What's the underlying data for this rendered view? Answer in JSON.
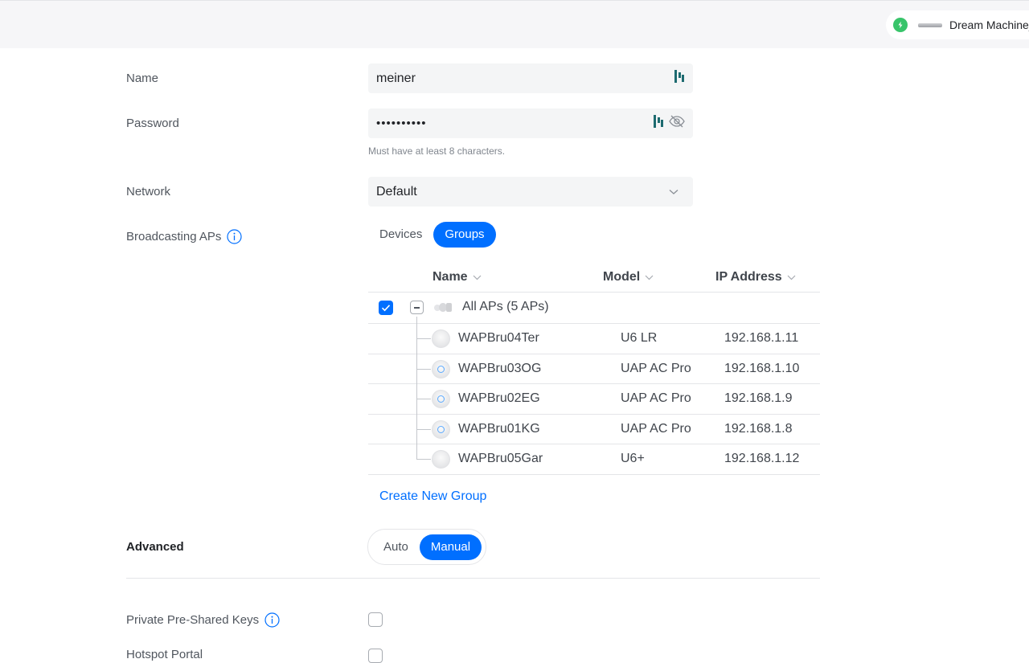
{
  "topbar": {
    "device_name": "Dream Machine_",
    "status_color": "#38c46a"
  },
  "form": {
    "name_label": "Name",
    "name_value": "meiner",
    "password_label": "Password",
    "password_value": "••••••••••",
    "password_hint": "Must have at least 8 characters.",
    "network_label": "Network",
    "network_value": "Default",
    "broadcasting_label": "Broadcasting APs",
    "broadcast_tabs": [
      "Devices",
      "Groups"
    ],
    "broadcast_active": "Groups",
    "advanced_label": "Advanced",
    "advanced_tabs": [
      "Auto",
      "Manual"
    ],
    "advanced_active": "Manual",
    "ppsk_label": "Private Pre-Shared Keys",
    "hotspot_label": "Hotspot Portal"
  },
  "table": {
    "columns": [
      "Name",
      "Model",
      "IP Address"
    ],
    "group_label": "All APs (5 APs)",
    "rows": [
      {
        "name": "WAPBru04Ter",
        "model": "U6 LR",
        "ip": "192.168.1.11",
        "icon": "ap-u6-icon"
      },
      {
        "name": "WAPBru03OG",
        "model": "UAP AC Pro",
        "ip": "192.168.1.10",
        "icon": "ap-acpro-icon"
      },
      {
        "name": "WAPBru02EG",
        "model": "UAP AC Pro",
        "ip": "192.168.1.9",
        "icon": "ap-acpro-icon"
      },
      {
        "name": "WAPBru01KG",
        "model": "UAP AC Pro",
        "ip": "192.168.1.8",
        "icon": "ap-acpro-icon"
      },
      {
        "name": "WAPBru05Gar",
        "model": "U6+",
        "ip": "192.168.1.12",
        "icon": "ap-u6-icon"
      }
    ],
    "create_group_label": "Create New Group"
  },
  "colors": {
    "accent": "#006fff",
    "text": "#212327",
    "muted": "#50565e"
  }
}
